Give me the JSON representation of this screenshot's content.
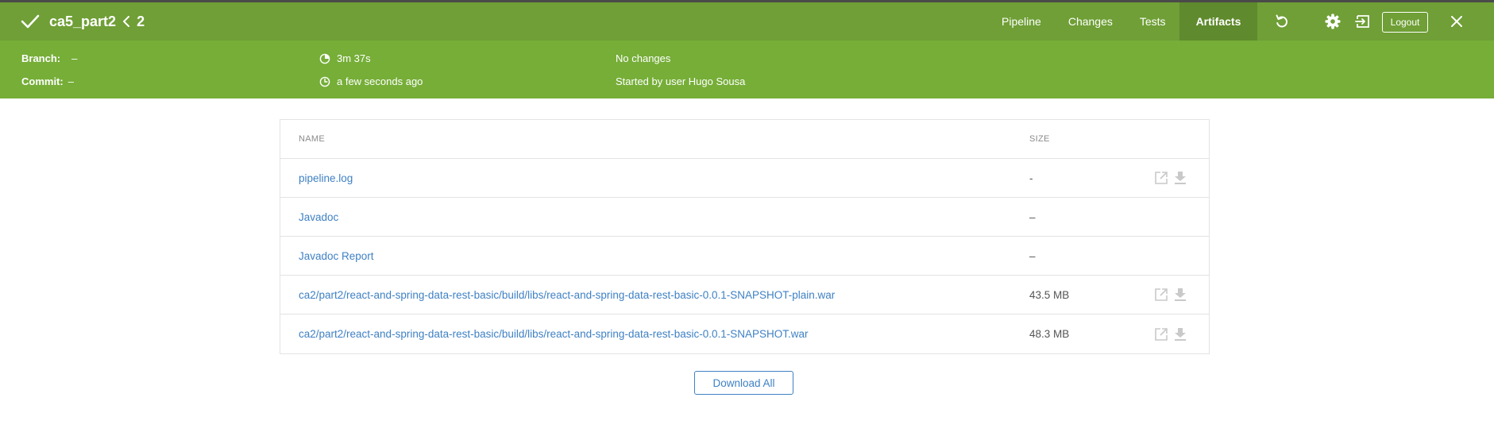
{
  "colors": {
    "header": "#6f9f36",
    "subheader": "#76ae38",
    "active_tab": "#5f8a2d",
    "link": "#3f81c4"
  },
  "header": {
    "run_name": "ca5_part2",
    "run_number": "2",
    "tabs": [
      {
        "label": "Pipeline",
        "active": false
      },
      {
        "label": "Changes",
        "active": false
      },
      {
        "label": "Tests",
        "active": false
      },
      {
        "label": "Artifacts",
        "active": true
      }
    ],
    "logout_label": "Logout",
    "icons": [
      "check-icon",
      "chevron-left-icon",
      "replay-icon",
      "gear-icon",
      "exit-icon",
      "close-icon"
    ]
  },
  "meta": {
    "branch_label": "Branch:",
    "branch_value": "–",
    "commit_label": "Commit:",
    "commit_value": "–",
    "duration": "3m 37s",
    "started": "a few seconds ago",
    "changes": "No changes",
    "started_by": "Started by user Hugo Sousa"
  },
  "artifacts": {
    "columns": {
      "name": "NAME",
      "size": "SIZE"
    },
    "rows": [
      {
        "name": "pipeline.log",
        "size": "-",
        "actions": true
      },
      {
        "name": "Javadoc",
        "size": "–",
        "actions": false
      },
      {
        "name": "Javadoc Report",
        "size": "–",
        "actions": false
      },
      {
        "name": "ca2/part2/react-and-spring-data-rest-basic/build/libs/react-and-spring-data-rest-basic-0.0.1-SNAPSHOT-plain.war",
        "size": "43.5 MB",
        "actions": true
      },
      {
        "name": "ca2/part2/react-and-spring-data-rest-basic/build/libs/react-and-spring-data-rest-basic-0.0.1-SNAPSHOT.war",
        "size": "48.3 MB",
        "actions": true
      }
    ],
    "download_all_label": "Download All"
  }
}
